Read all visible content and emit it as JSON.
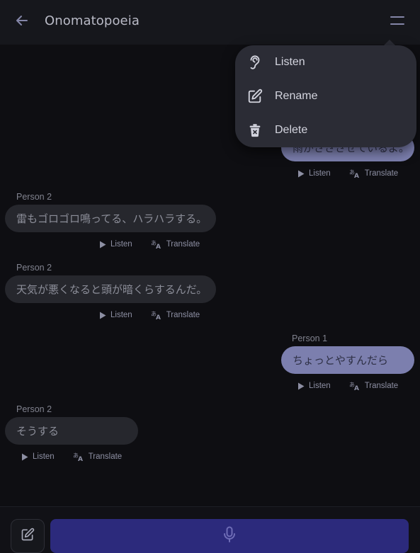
{
  "header": {
    "title": "Onomatopoeia",
    "back_icon": "arrow-left-icon",
    "menu_icon": "menu-icon"
  },
  "menu": {
    "items": [
      {
        "label": "Listen",
        "icon": "ear-icon"
      },
      {
        "label": "Rename",
        "icon": "pencil-square-icon"
      },
      {
        "label": "Delete",
        "icon": "trash-icon"
      }
    ]
  },
  "messages": [
    {
      "speaker": "",
      "text": "雨がさささせているよ。",
      "side": "right"
    },
    {
      "speaker": "Person 2",
      "text": "雷もゴロゴロ鳴ってる、ハラハラする。",
      "side": "left"
    },
    {
      "speaker": "Person 2",
      "text": "天気が悪くなると頭が暗くらするんだ。",
      "side": "left"
    },
    {
      "speaker": "Person 1",
      "text": "ちょっとやすんだら",
      "side": "right"
    },
    {
      "speaker": "Person 2",
      "text": "そうする",
      "side": "left"
    }
  ],
  "actions": {
    "listen_label": "Listen",
    "translate_label": "Translate"
  },
  "footer": {
    "edit_icon": "edit-icon",
    "mic_icon": "microphone-icon"
  },
  "colors": {
    "background": "#0e0e12",
    "header": "#16171c",
    "bubble_other": "#26272d",
    "bubble_me": "#7c7fae",
    "mic_button": "#2c2a7c",
    "menu_bg": "#2b2c35"
  }
}
